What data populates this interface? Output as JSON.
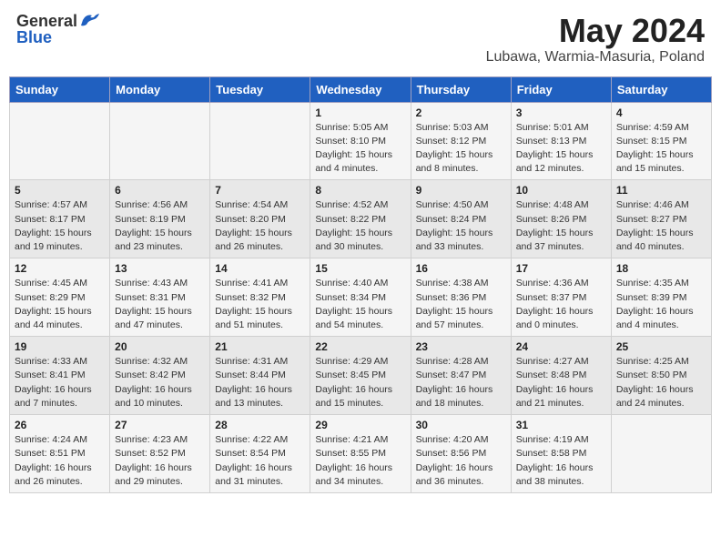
{
  "header": {
    "logo_general": "General",
    "logo_blue": "Blue",
    "month_title": "May 2024",
    "location": "Lubawa, Warmia-Masuria, Poland"
  },
  "days_of_week": [
    "Sunday",
    "Monday",
    "Tuesday",
    "Wednesday",
    "Thursday",
    "Friday",
    "Saturday"
  ],
  "weeks": [
    [
      {
        "num": "",
        "info": ""
      },
      {
        "num": "",
        "info": ""
      },
      {
        "num": "",
        "info": ""
      },
      {
        "num": "1",
        "info": "Sunrise: 5:05 AM\nSunset: 8:10 PM\nDaylight: 15 hours\nand 4 minutes."
      },
      {
        "num": "2",
        "info": "Sunrise: 5:03 AM\nSunset: 8:12 PM\nDaylight: 15 hours\nand 8 minutes."
      },
      {
        "num": "3",
        "info": "Sunrise: 5:01 AM\nSunset: 8:13 PM\nDaylight: 15 hours\nand 12 minutes."
      },
      {
        "num": "4",
        "info": "Sunrise: 4:59 AM\nSunset: 8:15 PM\nDaylight: 15 hours\nand 15 minutes."
      }
    ],
    [
      {
        "num": "5",
        "info": "Sunrise: 4:57 AM\nSunset: 8:17 PM\nDaylight: 15 hours\nand 19 minutes."
      },
      {
        "num": "6",
        "info": "Sunrise: 4:56 AM\nSunset: 8:19 PM\nDaylight: 15 hours\nand 23 minutes."
      },
      {
        "num": "7",
        "info": "Sunrise: 4:54 AM\nSunset: 8:20 PM\nDaylight: 15 hours\nand 26 minutes."
      },
      {
        "num": "8",
        "info": "Sunrise: 4:52 AM\nSunset: 8:22 PM\nDaylight: 15 hours\nand 30 minutes."
      },
      {
        "num": "9",
        "info": "Sunrise: 4:50 AM\nSunset: 8:24 PM\nDaylight: 15 hours\nand 33 minutes."
      },
      {
        "num": "10",
        "info": "Sunrise: 4:48 AM\nSunset: 8:26 PM\nDaylight: 15 hours\nand 37 minutes."
      },
      {
        "num": "11",
        "info": "Sunrise: 4:46 AM\nSunset: 8:27 PM\nDaylight: 15 hours\nand 40 minutes."
      }
    ],
    [
      {
        "num": "12",
        "info": "Sunrise: 4:45 AM\nSunset: 8:29 PM\nDaylight: 15 hours\nand 44 minutes."
      },
      {
        "num": "13",
        "info": "Sunrise: 4:43 AM\nSunset: 8:31 PM\nDaylight: 15 hours\nand 47 minutes."
      },
      {
        "num": "14",
        "info": "Sunrise: 4:41 AM\nSunset: 8:32 PM\nDaylight: 15 hours\nand 51 minutes."
      },
      {
        "num": "15",
        "info": "Sunrise: 4:40 AM\nSunset: 8:34 PM\nDaylight: 15 hours\nand 54 minutes."
      },
      {
        "num": "16",
        "info": "Sunrise: 4:38 AM\nSunset: 8:36 PM\nDaylight: 15 hours\nand 57 minutes."
      },
      {
        "num": "17",
        "info": "Sunrise: 4:36 AM\nSunset: 8:37 PM\nDaylight: 16 hours\nand 0 minutes."
      },
      {
        "num": "18",
        "info": "Sunrise: 4:35 AM\nSunset: 8:39 PM\nDaylight: 16 hours\nand 4 minutes."
      }
    ],
    [
      {
        "num": "19",
        "info": "Sunrise: 4:33 AM\nSunset: 8:41 PM\nDaylight: 16 hours\nand 7 minutes."
      },
      {
        "num": "20",
        "info": "Sunrise: 4:32 AM\nSunset: 8:42 PM\nDaylight: 16 hours\nand 10 minutes."
      },
      {
        "num": "21",
        "info": "Sunrise: 4:31 AM\nSunset: 8:44 PM\nDaylight: 16 hours\nand 13 minutes."
      },
      {
        "num": "22",
        "info": "Sunrise: 4:29 AM\nSunset: 8:45 PM\nDaylight: 16 hours\nand 15 minutes."
      },
      {
        "num": "23",
        "info": "Sunrise: 4:28 AM\nSunset: 8:47 PM\nDaylight: 16 hours\nand 18 minutes."
      },
      {
        "num": "24",
        "info": "Sunrise: 4:27 AM\nSunset: 8:48 PM\nDaylight: 16 hours\nand 21 minutes."
      },
      {
        "num": "25",
        "info": "Sunrise: 4:25 AM\nSunset: 8:50 PM\nDaylight: 16 hours\nand 24 minutes."
      }
    ],
    [
      {
        "num": "26",
        "info": "Sunrise: 4:24 AM\nSunset: 8:51 PM\nDaylight: 16 hours\nand 26 minutes."
      },
      {
        "num": "27",
        "info": "Sunrise: 4:23 AM\nSunset: 8:52 PM\nDaylight: 16 hours\nand 29 minutes."
      },
      {
        "num": "28",
        "info": "Sunrise: 4:22 AM\nSunset: 8:54 PM\nDaylight: 16 hours\nand 31 minutes."
      },
      {
        "num": "29",
        "info": "Sunrise: 4:21 AM\nSunset: 8:55 PM\nDaylight: 16 hours\nand 34 minutes."
      },
      {
        "num": "30",
        "info": "Sunrise: 4:20 AM\nSunset: 8:56 PM\nDaylight: 16 hours\nand 36 minutes."
      },
      {
        "num": "31",
        "info": "Sunrise: 4:19 AM\nSunset: 8:58 PM\nDaylight: 16 hours\nand 38 minutes."
      },
      {
        "num": "",
        "info": ""
      }
    ]
  ]
}
